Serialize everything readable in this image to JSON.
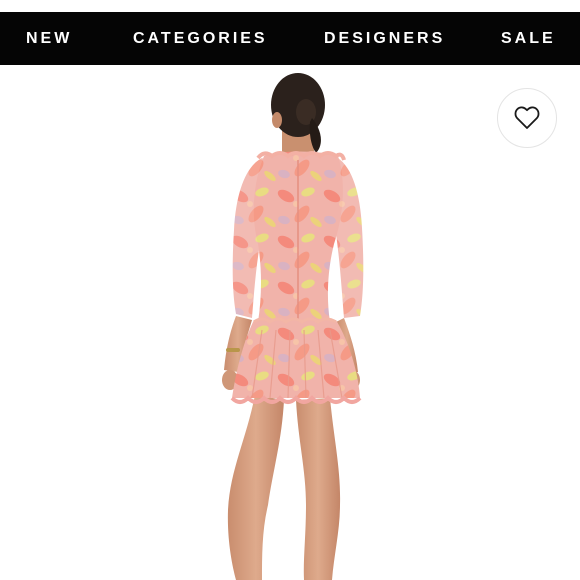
{
  "nav": {
    "items": [
      {
        "label": "NEW"
      },
      {
        "label": "CATEGORIES"
      },
      {
        "label": "DESIGNERS"
      },
      {
        "label": "SALE"
      }
    ]
  },
  "product_image": {
    "subject": "model-back-view-floral-mini-dress",
    "dress_colors": [
      "#f1a6a0",
      "#e9d97a",
      "#f59a86",
      "#d7aebc"
    ]
  },
  "favorite": {
    "icon": "heart-outline-icon"
  },
  "colors": {
    "nav_background": "#050505",
    "nav_text": "#ffffff",
    "page_background": "#ffffff"
  }
}
